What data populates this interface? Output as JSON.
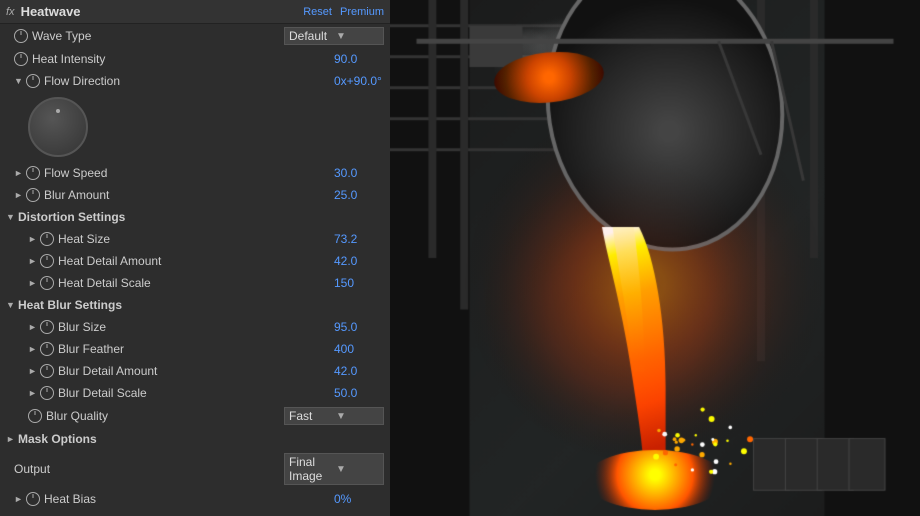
{
  "header": {
    "fx_label": "fx",
    "title": "Heatwave",
    "reset_label": "Reset",
    "premium_label": "Premium"
  },
  "controls": {
    "wave_type": {
      "label": "Wave Type",
      "value": "Default",
      "type": "dropdown"
    },
    "heat_intensity": {
      "label": "Heat Intensity",
      "value": "90.0"
    },
    "flow_direction": {
      "label": "Flow Direction",
      "value": "0x+90.0°"
    },
    "flow_speed": {
      "label": "Flow Speed",
      "value": "30.0"
    },
    "blur_amount": {
      "label": "Blur Amount",
      "value": "25.0"
    },
    "distortion_settings": {
      "label": "Distortion Settings",
      "heat_size": {
        "label": "Heat Size",
        "value": "73.2"
      },
      "heat_detail_amount": {
        "label": "Heat Detail Amount",
        "value": "42.0"
      },
      "heat_detail_scale": {
        "label": "Heat Detail Scale",
        "value": "150"
      }
    },
    "heat_blur_settings": {
      "label": "Heat Blur Settings",
      "blur_size": {
        "label": "Blur Size",
        "value": "95.0"
      },
      "blur_feather": {
        "label": "Blur Feather",
        "value": "400"
      },
      "blur_detail_amount": {
        "label": "Blur Detail Amount",
        "value": "42.0"
      },
      "blur_detail_scale": {
        "label": "Blur Detail Scale",
        "value": "50.0"
      },
      "blur_quality": {
        "label": "Blur Quality",
        "value": "Fast",
        "type": "dropdown"
      }
    },
    "mask_options": {
      "label": "Mask Options"
    },
    "output": {
      "label": "Output",
      "value": "Final Image",
      "type": "dropdown"
    },
    "heat_bias": {
      "label": "Heat Bias",
      "value": "0%"
    }
  }
}
